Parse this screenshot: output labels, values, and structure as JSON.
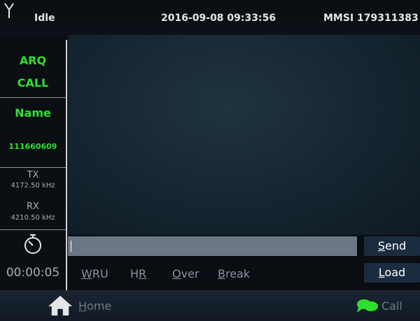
{
  "topbar": {
    "status": "Idle",
    "datetime": "2016-09-08 09:33:56",
    "mmsi": "MMSI 179311383",
    "icon": "antenna-icon"
  },
  "sidebar": {
    "mode_line1": "ARQ",
    "mode_line2": "CALL",
    "name_label": "Name",
    "name_value": "111660609",
    "tx_label": "TX",
    "tx_freq": "4172.50 kHz",
    "rx_label": "RX",
    "rx_freq": "4210.50 kHz",
    "timer_icon": "stopwatch-icon",
    "timer": "00:00:05"
  },
  "composer": {
    "input_value": "",
    "send_first": "S",
    "send_rest": "end",
    "load_first": "L",
    "load_rest": "oad"
  },
  "quick_actions": [
    {
      "before": "",
      "underline": "W",
      "after": "RU"
    },
    {
      "before": "H",
      "underline": "R",
      "after": ""
    },
    {
      "before": "",
      "underline": "O",
      "after": "ver"
    },
    {
      "before": "",
      "underline": "B",
      "after": "reak"
    }
  ],
  "footer": {
    "home_first": "H",
    "home_rest": "ome",
    "home_icon": "home-icon",
    "call_label": "Call",
    "call_icon": "chat-bubbles-icon"
  },
  "colors": {
    "accent_green": "#2ee02e",
    "button_bg": "#1a2c40",
    "input_bg": "#6b7884"
  }
}
